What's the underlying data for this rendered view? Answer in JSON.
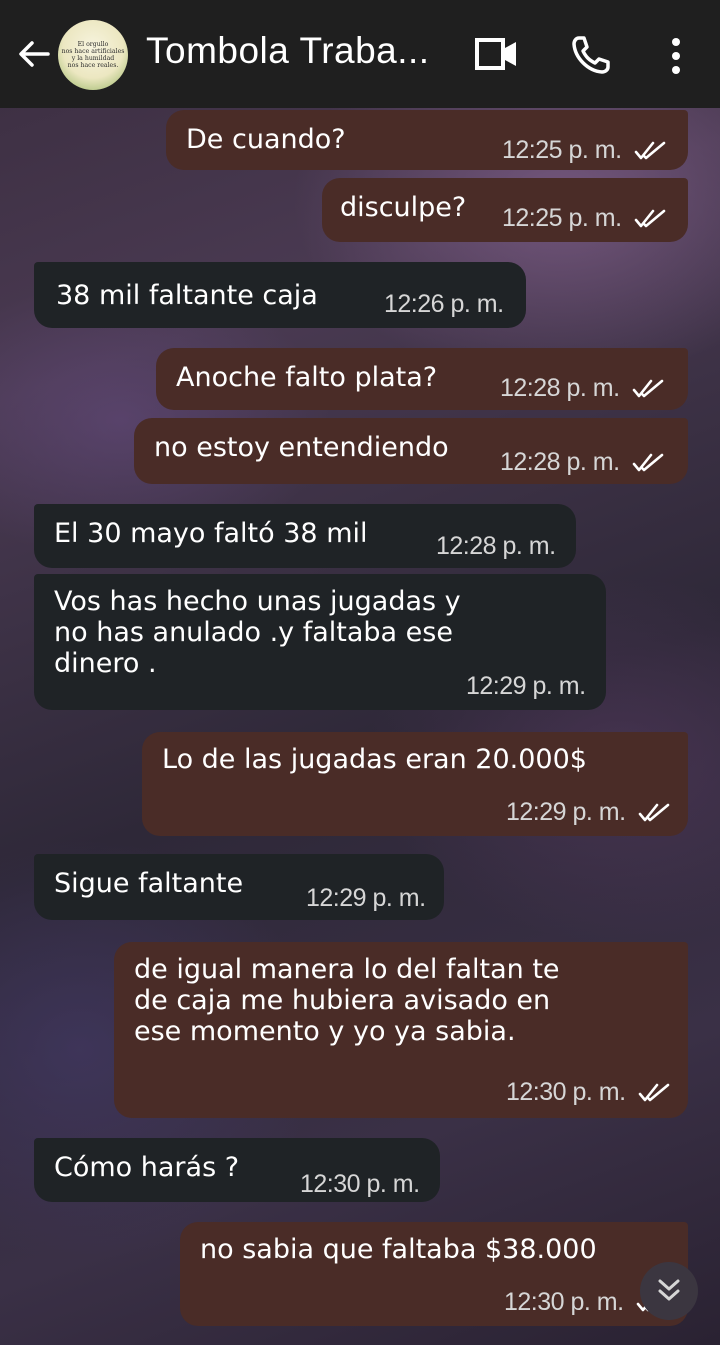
{
  "header": {
    "title": "Tombola Traba...",
    "avatar_text": [
      "El orgullo",
      "nos hace artificiales",
      "y la humildad",
      "nos hace reales."
    ]
  },
  "colors": {
    "outgoing": "#4a2c27",
    "incoming": "#1f2326",
    "header": "#1f1f1f",
    "read_ticks": "#ffffff"
  },
  "icons": {
    "back": "arrow-left-icon",
    "video": "video-camera-icon",
    "call": "phone-icon",
    "menu": "more-vertical-icon",
    "scroll": "double-chevron-down-icon",
    "read": "double-check-icon"
  },
  "messages": [
    {
      "dir": "out",
      "lines": [
        "De cuando?"
      ],
      "time": "12:25 p. m."
    },
    {
      "dir": "out",
      "lines": [
        "disculpe?"
      ],
      "time": "12:25 p. m."
    },
    {
      "dir": "in",
      "lines": [
        "38 mil faltante caja"
      ],
      "time": "12:26 p. m."
    },
    {
      "dir": "out",
      "lines": [
        "Anoche falto plata?"
      ],
      "time": "12:28 p. m."
    },
    {
      "dir": "out",
      "lines": [
        "no estoy entendiendo"
      ],
      "time": "12:28 p. m."
    },
    {
      "dir": "in",
      "lines": [
        "El 30 mayo faltó 38 mil"
      ],
      "time": "12:28 p. m."
    },
    {
      "dir": "in",
      "lines": [
        "Vos has hecho unas jugadas y",
        "no has anulado .y faltaba ese",
        "dinero ."
      ],
      "time": "12:29 p. m."
    },
    {
      "dir": "out",
      "lines": [
        "Lo de las jugadas eran 20.000$"
      ],
      "time": "12:29 p. m."
    },
    {
      "dir": "in",
      "lines": [
        "Sigue faltante"
      ],
      "time": "12:29 p. m."
    },
    {
      "dir": "out",
      "lines": [
        "de igual manera lo del faltan te",
        "de caja me hubiera avisado en",
        "ese momento y yo ya sabia."
      ],
      "time": "12:30 p. m."
    },
    {
      "dir": "in",
      "lines": [
        "Cómo harás ?"
      ],
      "time": "12:30 p. m."
    },
    {
      "dir": "out",
      "lines": [
        "no sabia que faltaba $38.000"
      ],
      "time": "12:30 p. m."
    }
  ]
}
